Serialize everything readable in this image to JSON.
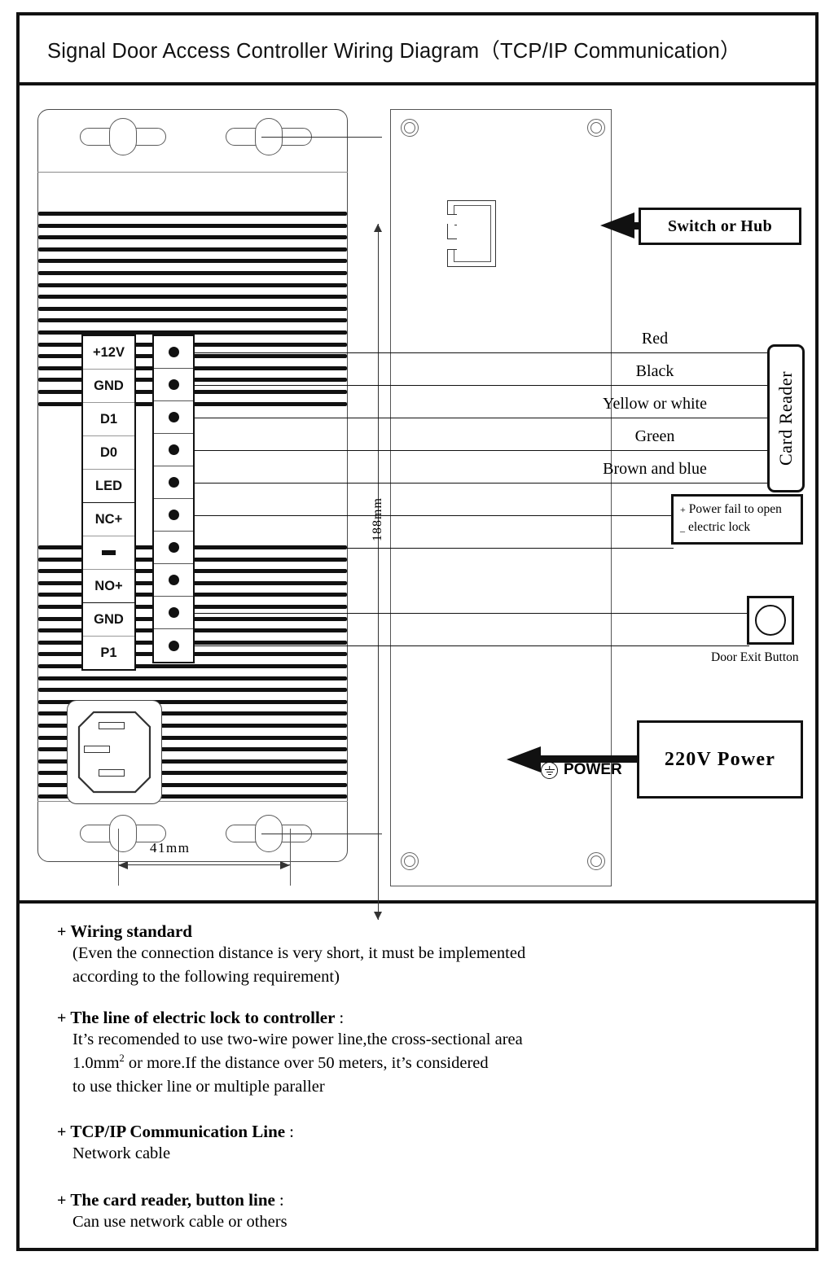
{
  "title": "Signal Door Access Controller Wiring Diagram（TCP/IP  Communication）",
  "dimensions": {
    "height_label": "188mm",
    "width_label": "41mm"
  },
  "terminals": [
    {
      "name": "+12V"
    },
    {
      "name": "GND"
    },
    {
      "name": "D1"
    },
    {
      "name": "D0"
    },
    {
      "name": "LED"
    },
    {
      "name": "NC+"
    },
    {
      "name": "-"
    },
    {
      "name": "NO+"
    },
    {
      "name": "GND"
    },
    {
      "name": "P1"
    }
  ],
  "wire_labels": [
    "Red",
    "Black",
    "Yellow or white",
    "Green",
    "Brown and blue"
  ],
  "callouts": {
    "switch_or_hub": "Switch or Hub",
    "power_220v": "220V Power",
    "card_reader": "Card Reader",
    "electric_lock_line1": "Power fail to open",
    "electric_lock_line2": "electric lock",
    "electric_lock_plus": "+",
    "electric_lock_minus": "_",
    "door_exit_button": "Door  Exit Button",
    "power_label": "POWER"
  },
  "icons": {
    "rj45": "rj45-jack-icon",
    "iec_inlet": "iec-power-inlet-icon",
    "ground": "ground-symbol-icon"
  },
  "notes": [
    {
      "bullet": "+",
      "heading": "Wiring standard",
      "suffix": "",
      "lines": [
        "(Even the connection distance  is very short, it must be implemented",
        "according to the following requirement)"
      ]
    },
    {
      "bullet": "+",
      "heading": "The line of electric lock to controller",
      "suffix": ":",
      "lines": [
        "It’s recomended to use two-wire power line,the cross-sectional area",
        "1.0mm²  or more.If the distance over 50 meters, it’s considered",
        "to use  thicker line or multiple paraller"
      ]
    },
    {
      "bullet": "+",
      "heading": "TCP/IP  Communication Line",
      "suffix": ":",
      "lines": [
        "Network cable"
      ]
    },
    {
      "bullet": "+",
      "heading": "The card reader, button line",
      "suffix": ":",
      "lines": [
        "Can use network cable or others"
      ]
    }
  ]
}
